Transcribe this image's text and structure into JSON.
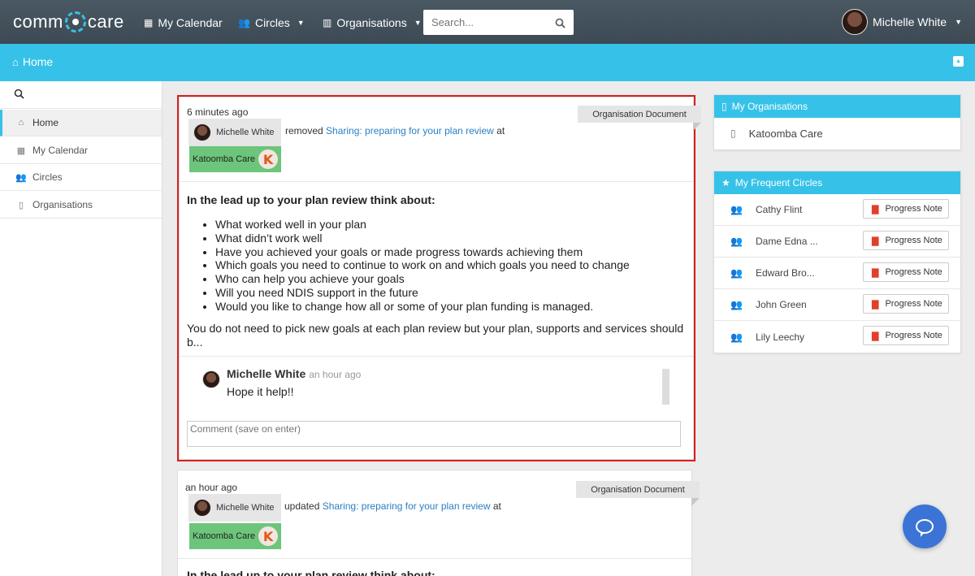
{
  "app": {
    "logo_left": "comm",
    "logo_right": "care"
  },
  "nav": {
    "my_calendar": "My Calendar",
    "circles": "Circles",
    "organisations": "Organisations",
    "search_placeholder": "Search...",
    "user_name": "Michelle White"
  },
  "breadcrumb": {
    "home": "Home"
  },
  "sidebar": {
    "items": [
      {
        "label": "Home",
        "icon": "home-icon"
      },
      {
        "label": "My Calendar",
        "icon": "calendar-icon"
      },
      {
        "label": "Circles",
        "icon": "users-icon"
      },
      {
        "label": "Organisations",
        "icon": "building-icon"
      }
    ]
  },
  "feed": [
    {
      "time": "6 minutes ago",
      "tag": "Organisation Document",
      "user": "Michelle White",
      "verb": "removed",
      "doc_link": "Sharing: preparing for your plan review",
      "at": "at",
      "org": "Katoomba Care",
      "heading": "In the lead up to your plan review think about:",
      "bullets": [
        "What worked well in your plan",
        "What didn’t work well",
        "Have you achieved your goals or made progress towards achieving them",
        "Which goals you need to continue to work on and which goals you need to change",
        "Who can help you achieve your goals",
        "Will you need NDIS support in the future",
        "Would you like to change how all or some of your plan funding is managed."
      ],
      "excerpt": "You do not need to pick new goals at each plan review but your plan, supports and services should b...",
      "comment": {
        "author": "Michelle White",
        "time": "an hour ago",
        "text": "Hope it help!!"
      },
      "comment_placeholder": "Comment (save on enter)"
    },
    {
      "time": "an hour ago",
      "tag": "Organisation Document",
      "user": "Michelle White",
      "verb": "updated",
      "doc_link": "Sharing: preparing for your plan review",
      "at": "at",
      "org": "Katoomba Care",
      "heading": "In the lead up to your plan review think about:"
    }
  ],
  "my_organisations": {
    "title": "My Organisations",
    "items": [
      "Katoomba Care"
    ]
  },
  "frequent_circles": {
    "title": "My Frequent Circles",
    "button_label": "Progress Note",
    "items": [
      "Cathy Flint",
      "Dame Edna ...",
      "Edward Bro...",
      "John Green",
      "Lily Leechy"
    ]
  },
  "colors": {
    "accent": "#36c2e8",
    "navbar": "#3d4a54",
    "org_chip": "#6cc57a",
    "highlight": "#d91e1e",
    "fab": "#3b74d6"
  }
}
